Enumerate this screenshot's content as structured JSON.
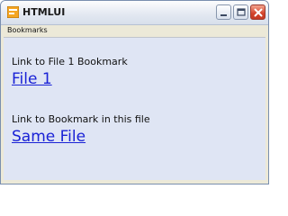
{
  "window": {
    "title": "HTMLUI",
    "icon": "html-app-icon",
    "caption_buttons": [
      "minimize-icon",
      "maximize-icon",
      "close-icon"
    ]
  },
  "menubar": {
    "items": [
      {
        "label": "Bookmarks"
      }
    ]
  },
  "main": {
    "sections": [
      {
        "label": "Link to File 1 Bookmark",
        "link": "File 1"
      },
      {
        "label": "Link to Bookmark in this file",
        "link": "Same File"
      }
    ]
  },
  "colors": {
    "content_bg": "#dfe5f4",
    "link": "#1a22d6",
    "close_button": "#d3432b"
  }
}
